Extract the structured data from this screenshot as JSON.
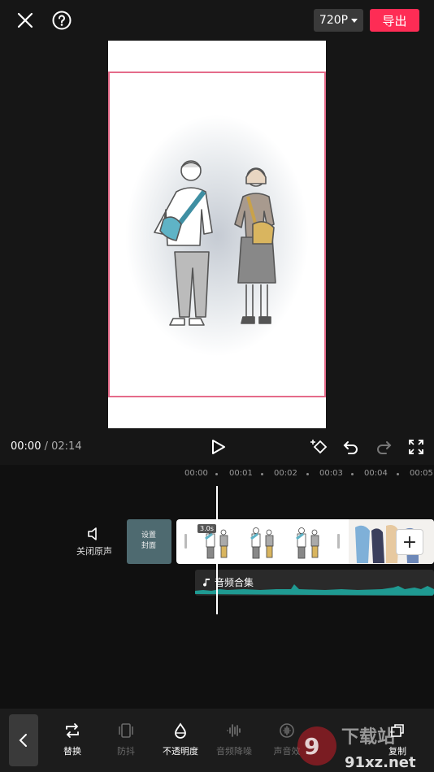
{
  "header": {
    "resolution": "720P",
    "export_label": "导出"
  },
  "playback": {
    "current_time": "00:00",
    "total_time": "/ 02:14"
  },
  "ruler": {
    "ticks": [
      "00:00",
      "00:01",
      "00:02",
      "00:03",
      "00:04",
      "00:05"
    ]
  },
  "tracks": {
    "mute_label": "关闭原声",
    "cover_label_1": "设置",
    "cover_label_2": "封面",
    "clip_duration": "3.0s",
    "add_symbol": "+",
    "audio_label": "音频合集"
  },
  "toolbar": {
    "items": [
      {
        "label": "替换",
        "enabled": true
      },
      {
        "label": "防抖",
        "enabled": false
      },
      {
        "label": "不透明度",
        "enabled": true
      },
      {
        "label": "音频降噪",
        "enabled": false
      },
      {
        "label": "声音效",
        "enabled": false
      },
      {
        "label": "复制",
        "enabled": true
      }
    ]
  },
  "watermark": {
    "text": "91xz.net"
  },
  "colors": {
    "accent": "#fe2c55",
    "selection": "#e56b8a",
    "audio_wave": "#2aa198"
  }
}
